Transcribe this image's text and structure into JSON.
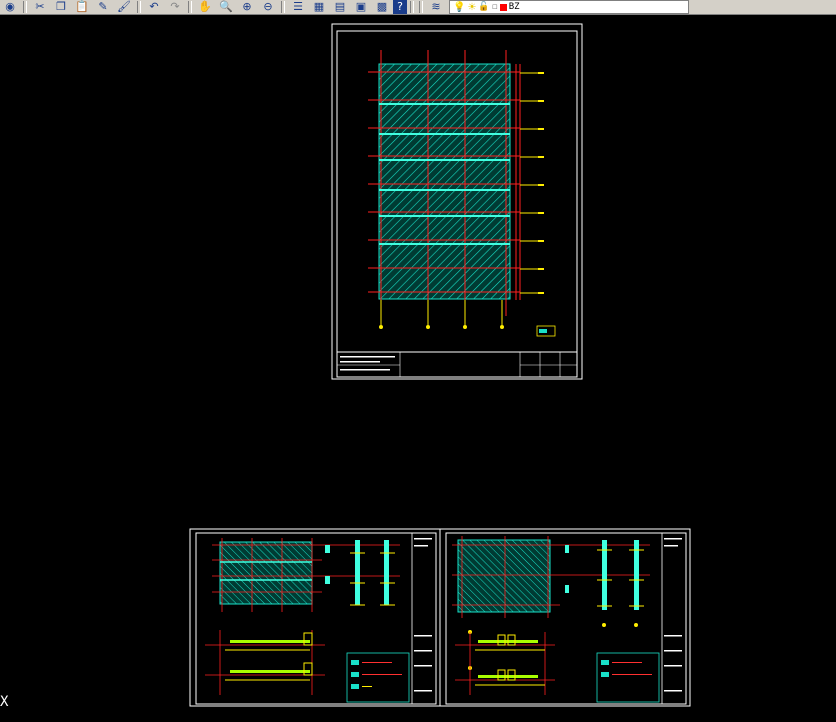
{
  "toolbar": {
    "icons": [
      "globe-icon",
      "cut-icon",
      "copy-icon",
      "paste-icon",
      "match-properties-icon",
      "brush-icon",
      "undo-icon",
      "redo-icon",
      "pan-icon",
      "zoom-realtime-icon",
      "zoom-window-icon",
      "zoom-previous-icon",
      "properties-icon",
      "design-center-icon",
      "tool-palette-icon",
      "sheetset-icon",
      "calculator-icon",
      "help-icon",
      "layer-manager-icon",
      "lightbulb-icon",
      "sun-icon",
      "lock-icon",
      "color-icon"
    ],
    "current_layer": "BZ",
    "layer_color": "#ff0000"
  },
  "canvas": {
    "background": "#000000",
    "ucs_label": "X"
  }
}
